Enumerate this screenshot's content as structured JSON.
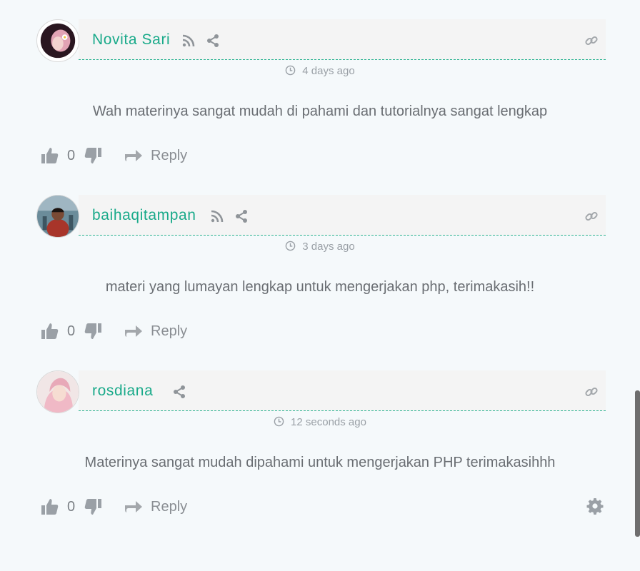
{
  "comments": [
    {
      "author": "Novita Sari",
      "time": "4 days ago",
      "text": "Wah materinya sangat mudah di pahami dan tutorialnya sangat lengkap",
      "votes": "0",
      "reply_label": "Reply",
      "avatar_colors": [
        "#3a1f2e",
        "#e0a7b6"
      ]
    },
    {
      "author": "baihaqitampan",
      "time": "3 days ago",
      "text": "materi yang lumayan lengkap untuk mengerjakan php, terimakasih!!",
      "votes": "0",
      "reply_label": "Reply",
      "avatar_colors": [
        "#4e6d7a",
        "#b03a2e"
      ]
    },
    {
      "author": "rosdiana",
      "time": "12 seconds ago",
      "text": "Materinya sangat mudah dipahami untuk mengerjakan PHP terimakasihhh",
      "votes": "0",
      "reply_label": "Reply",
      "avatar_colors": [
        "#f2d8d8",
        "#f0b3c0"
      ]
    }
  ],
  "icons": {
    "rss": "rss-icon",
    "share": "share-icon",
    "link": "link-icon",
    "clock": "clock-icon",
    "thumbs_up": "thumbs-up-icon",
    "thumbs_down": "thumbs-down-icon",
    "reply": "reply-arrow-icon",
    "settings": "gear-icon"
  },
  "colors": {
    "accent": "#1aaa8a",
    "header_bg": "#f4f4f4",
    "page_bg": "#f5f9fb",
    "icon_grey": "#9aa0a6"
  }
}
